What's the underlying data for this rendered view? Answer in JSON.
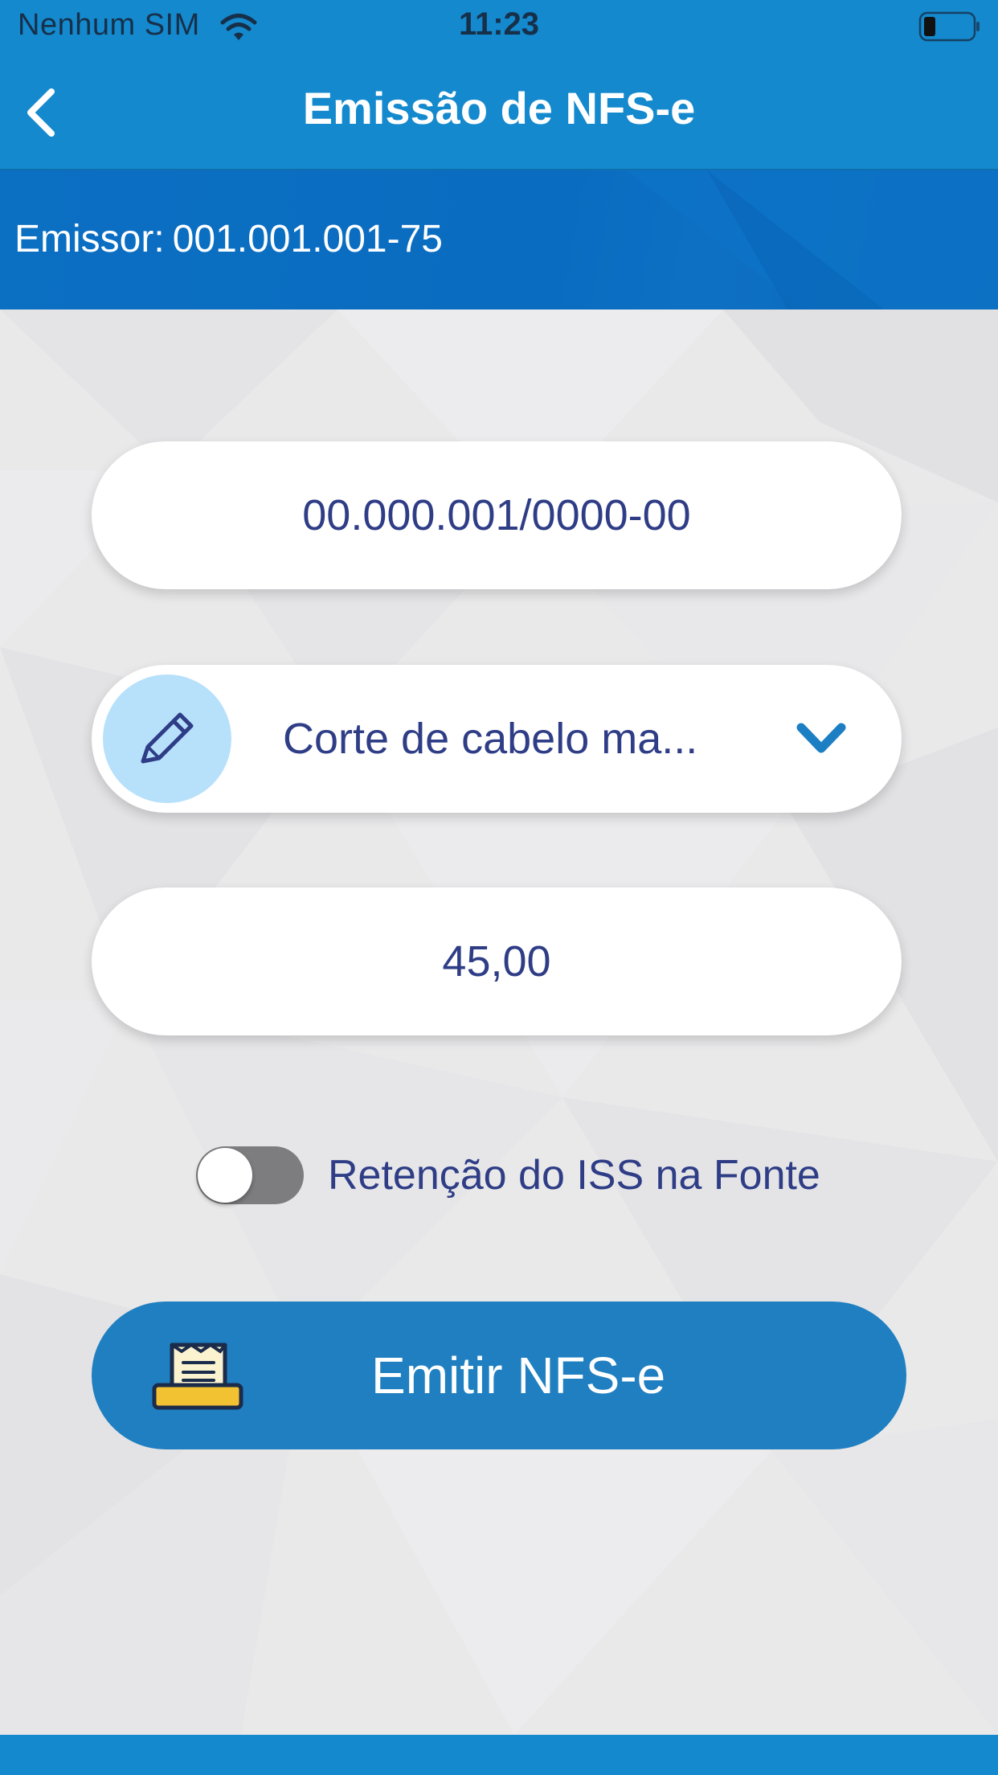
{
  "status_bar": {
    "carrier": "Nenhum SIM",
    "time": "11:23",
    "wifi_icon": "wifi-icon",
    "battery_icon": "battery-icon"
  },
  "nav": {
    "title": "Emissão de NFS-e",
    "back_icon": "chevron-left-icon"
  },
  "emitter": {
    "label": "Emissor:",
    "value": "001.001.001-75"
  },
  "form": {
    "taker_document": "00.000.001/0000-00",
    "service": {
      "icon": "pencil-icon",
      "value": "Corte de cabelo ma...",
      "dropdown_icon": "chevron-down-icon"
    },
    "amount": "45,00",
    "iss_withholding": {
      "label": "Retenção do ISS na Fonte",
      "enabled": false
    }
  },
  "actions": {
    "emit_label": "Emitir NFS-e",
    "emit_icon": "receipt-printer-icon"
  },
  "colors": {
    "primary": "#1489cd",
    "emitter_band": "#0b6fc2",
    "button": "#1f7fc1",
    "text": "#2e3d86",
    "pencil_circle": "#b7e1fb",
    "accent_yellow": "#f2c233"
  }
}
